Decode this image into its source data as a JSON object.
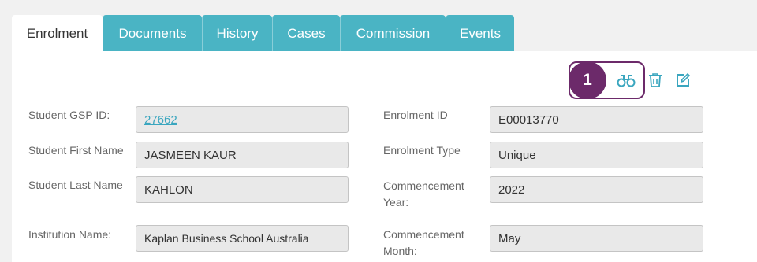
{
  "tabs": [
    {
      "label": "Enrolment"
    },
    {
      "label": "Documents"
    },
    {
      "label": "History"
    },
    {
      "label": "Cases"
    },
    {
      "label": "Commission"
    },
    {
      "label": "Events"
    }
  ],
  "toolbar": {
    "step_number": "1",
    "view_icon": "binoculars-icon",
    "delete_icon": "trash-icon",
    "edit_icon": "edit-icon",
    "accent_color": "#6c2a6a",
    "icon_color": "#3aa6bf"
  },
  "form": {
    "student_gsp_id": {
      "label": "Student GSP ID:",
      "value": "27662"
    },
    "student_first_name": {
      "label": "Student First Name",
      "value": "JASMEEN KAUR"
    },
    "student_last_name": {
      "label": "Student Last Name",
      "value": "KAHLON"
    },
    "institution_name": {
      "label": "Institution Name:",
      "value": "Kaplan Business School Australia"
    },
    "enrolment_id": {
      "label": "Enrolment ID",
      "value": "E00013770"
    },
    "enrolment_type": {
      "label": "Enrolment Type",
      "value": "Unique"
    },
    "commencement_year": {
      "label_line1": "Commencement",
      "label_line2": "Year:",
      "value": "2022"
    },
    "commencement_month": {
      "label_line1": "Commencement",
      "label_line2": "Month:",
      "value": "May"
    }
  }
}
